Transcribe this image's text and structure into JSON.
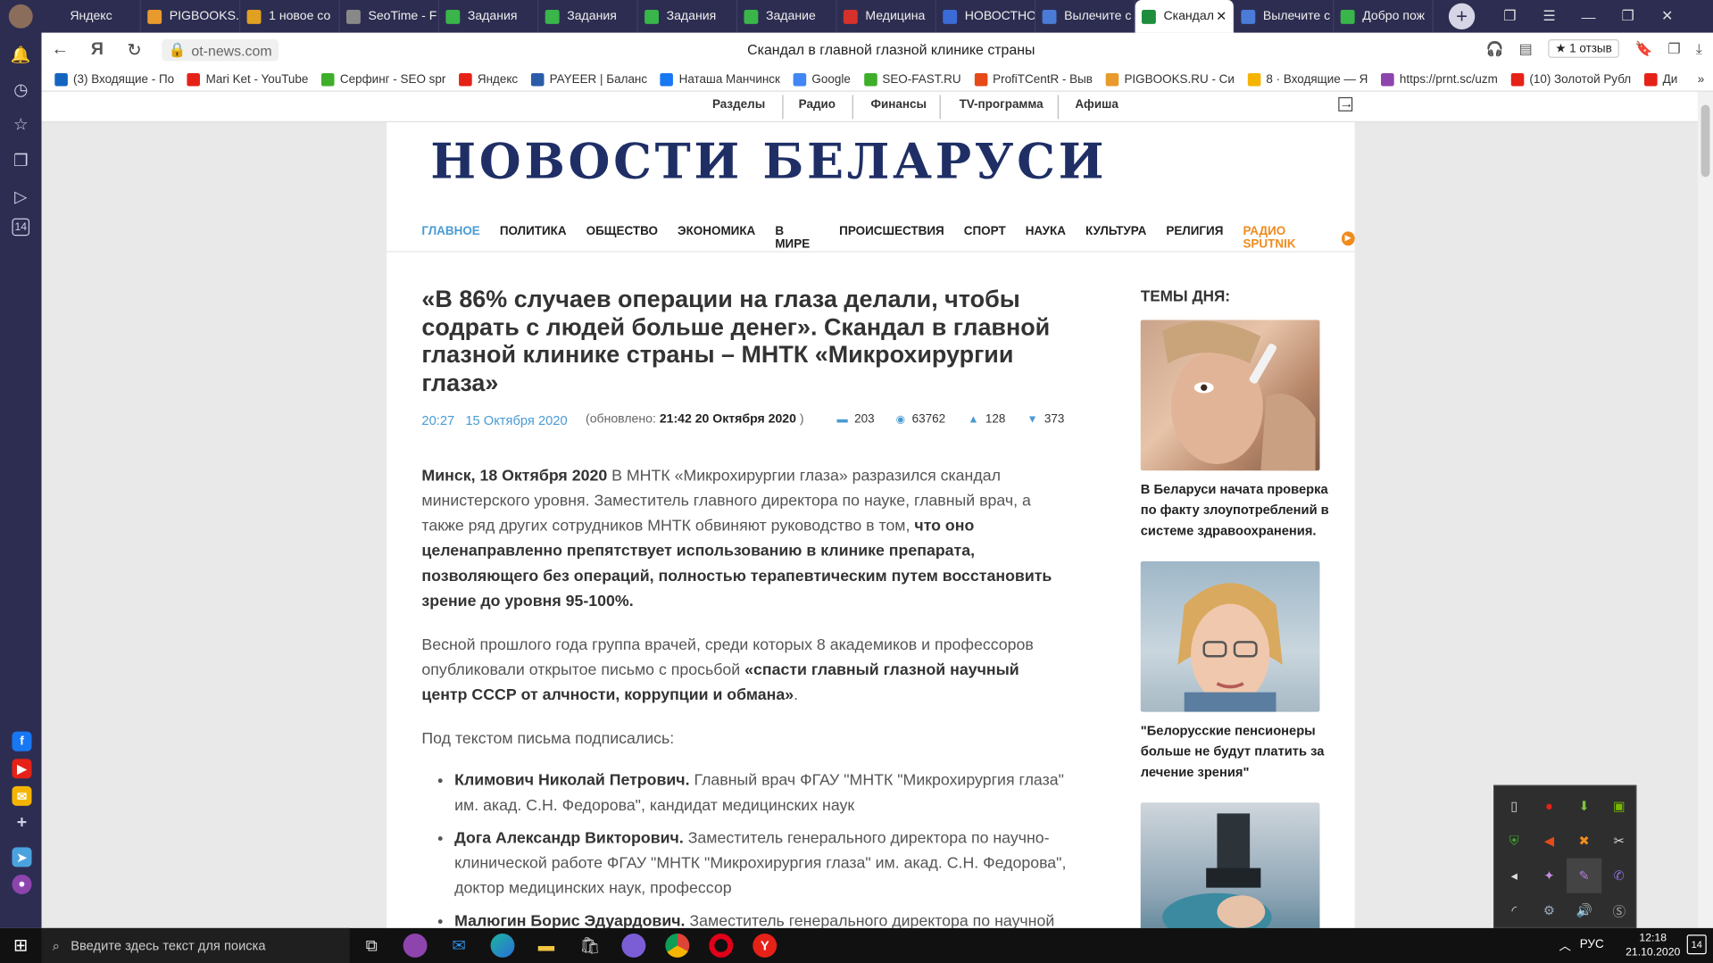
{
  "browser": {
    "tabs": [
      {
        "label": "Яндекс",
        "color": "#2d2d52"
      },
      {
        "label": "PIGBOOKS.R",
        "color": "#e89b2c"
      },
      {
        "label": "1 новое со",
        "color": "#e0a020"
      },
      {
        "label": "SeoTime - F",
        "color": "#888888"
      },
      {
        "label": "Задания",
        "color": "#39b54a"
      },
      {
        "label": "Задания",
        "color": "#39b54a"
      },
      {
        "label": "Задания",
        "color": "#39b54a"
      },
      {
        "label": "Задание",
        "color": "#39b54a"
      },
      {
        "label": "Медицина",
        "color": "#d6312a"
      },
      {
        "label": "НОВОСТНО",
        "color": "#3b6bd6"
      },
      {
        "label": "Вылечите с",
        "color": "#4a7bd6"
      },
      {
        "label": "Скандал",
        "color": "#1e8e3e",
        "active": true
      },
      {
        "label": "Вылечите с",
        "color": "#4a7bd6"
      },
      {
        "label": "Добро пож",
        "color": "#39b54a"
      }
    ],
    "url": "ot-news.com",
    "page_title": "Скандал в главной глазной клинике страны",
    "review_label": "★ 1 отзыв",
    "bookmarks": [
      {
        "label": "(3) Входящие - По",
        "color": "#1565c0"
      },
      {
        "label": "Mari Ket - YouTube",
        "color": "#e62117"
      },
      {
        "label": "Серфинг - SEO spr",
        "color": "#3fae2a"
      },
      {
        "label": "Яндекс",
        "color": "#e62117"
      },
      {
        "label": "PAYEER | Баланс",
        "color": "#2a5ca8"
      },
      {
        "label": "Наташа Манчинск",
        "color": "#1877f2"
      },
      {
        "label": "Google",
        "color": "#4285f4"
      },
      {
        "label": "SEO-FAST.RU",
        "color": "#3fae2a"
      },
      {
        "label": "ProfiTCentR - Выв",
        "color": "#e64a19"
      },
      {
        "label": "PIGBOOKS.RU - Си",
        "color": "#e89b2c"
      },
      {
        "label": "8 · Входящие — Я",
        "color": "#f4b400"
      },
      {
        "label": "https://prnt.sc/uzm",
        "color": "#8e44ad"
      },
      {
        "label": "(10) Золотой Рубл",
        "color": "#e62117"
      },
      {
        "label": "Ди",
        "color": "#e62117"
      }
    ]
  },
  "site": {
    "top_nav": [
      "Разделы",
      "Радио",
      "Финансы",
      "TV-программа",
      "Афиша"
    ],
    "logo": "НОВОСТИ БЕЛАРУСИ",
    "main_nav": [
      "ГЛАВНОЕ",
      "ПОЛИТИКА",
      "ОБЩЕСТВО",
      "ЭКОНОМИКА",
      "В МИРЕ",
      "ПРОИСШЕСТВИЯ",
      "СПОРТ",
      "НАУКА",
      "КУЛЬТУРА",
      "РЕЛИГИЯ"
    ],
    "radio_label": "РАДИО SPUTNIK",
    "sidebar_title": "ТЕМЫ ДНЯ:",
    "sidebar_items": [
      "В Беларуси начата проверка по факту злоупотреблений в системе здравоохранения.",
      "\"Белорусские пенсионеры больше не будут платить за лечение зрения\"",
      ""
    ]
  },
  "article": {
    "headline": "«В 86% случаев операции на глаза делали, чтобы содрать с людей больше денег». Скандал в главной глазной клинике страны – МНТК «Микрохирургии глаза»",
    "time": "20:27",
    "date": "15 Октября 2020",
    "updated_prefix": "(обновлено:",
    "updated_value": "21:42 20 Октября 2020",
    "updated_suffix": ")",
    "stats": {
      "comments": "203",
      "views": "63762",
      "likes": "128",
      "replies": "373"
    },
    "p1_lead": "Минск, 18 Октября 2020",
    "p1_text": " В МНТК «Микрохирургии глаза» разразился скандал министерского уровня. Заместитель главного директора по науке, главный врач, а также ряд других сотрудников МНТК обвиняют руководство в том, ",
    "p1_bold": "что оно целенаправленно препятствует использованию в клинике препарата, позволяющего без операций, полностью терапевтическим путем восстановить зрение до уровня 95-100%.",
    "p2_text": "Весной прошлого года группа врачей, среди которых 8 академиков и профессоров опубликовали открытое письмо с просьбой ",
    "p2_bold": "«спасти главный глазной научный центр СССР от алчности, коррупции и обмана»",
    "p2_end": ".",
    "p3": "Под текстом письма подписались:",
    "signers": [
      {
        "name": "Климович Николай Петрович.",
        "desc": " Главный врач ФГАУ \"МНТК \"Микрохирургия глаза\" им. акад. С.Н. Федорова\", кандидат медицинских наук"
      },
      {
        "name": "Дога Александр Викторович.",
        "desc": " Заместитель генерального директора по научно-клинической работе ФГАУ \"МНТК \"Микрохирургия глаза\" им. акад. С.Н. Федорова\", доктор медицинских наук, профессор"
      },
      {
        "name": "Малюгин Борис Эдуардович.",
        "desc": " Заместитель генерального директора по научной"
      }
    ]
  },
  "taskbar": {
    "search_placeholder": "Введите здесь текст для поиска",
    "lang": "РУС",
    "time": "12:18",
    "date": "21.10.2020",
    "notifications": "14"
  },
  "sidebar_left_badge": "14"
}
